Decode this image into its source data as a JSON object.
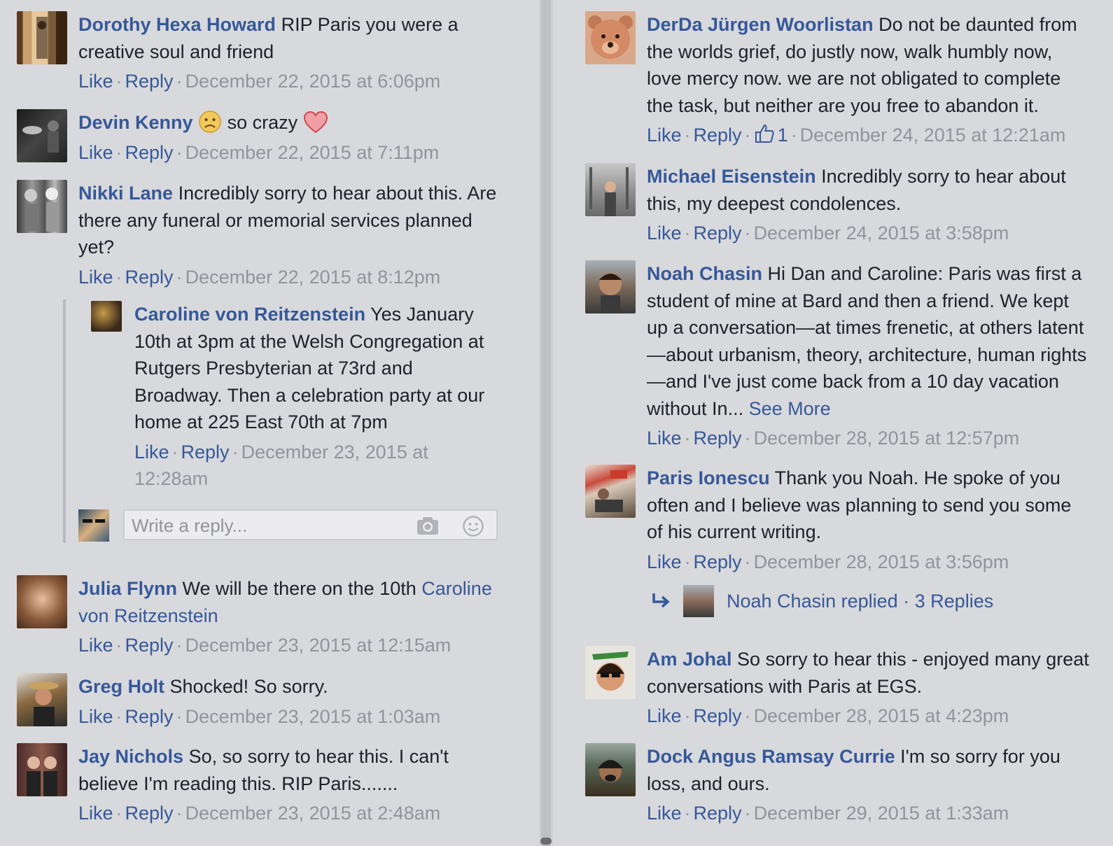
{
  "left": {
    "comments": [
      {
        "name": "Dorothy Hexa Howard",
        "text": "RIP Paris you were a creative soul and friend",
        "like": "Like",
        "reply": "Reply",
        "timestamp": "December 22, 2015 at 6:06pm"
      },
      {
        "name": "Devin Kenny",
        "text_before": "so crazy",
        "like": "Like",
        "reply": "Reply",
        "timestamp": "December 22, 2015 at 7:11pm"
      },
      {
        "name": "Nikki Lane",
        "text": "Incredibly sorry to hear about this. Are there any funeral or memorial services planned yet?",
        "like": "Like",
        "reply": "Reply",
        "timestamp": "December 22, 2015 at 8:12pm"
      },
      {
        "name": "Julia Flynn",
        "text": "We will be there on the 10th",
        "mention": "Caroline von Reitzenstein",
        "like": "Like",
        "reply": "Reply",
        "timestamp": "December 23, 2015 at 12:15am"
      },
      {
        "name": "Greg Holt",
        "text": "Shocked! So sorry.",
        "like": "Like",
        "reply": "Reply",
        "timestamp": "December 23, 2015 at 1:03am"
      },
      {
        "name": "Jay Nichols",
        "text": "So, so sorry to hear this. I can't believe I'm reading this. RIP Paris.......",
        "like": "Like",
        "reply": "Reply",
        "timestamp": "December 23, 2015 at 2:48am"
      }
    ],
    "nested_reply": {
      "name": "Caroline von Reitzenstein",
      "text": "Yes January 10th at 3pm at the Welsh Congregation at Rutgers Presbyterian at 73rd and Broadway. Then a celebration party at our home at 225 East 70th at 7pm",
      "like": "Like",
      "reply": "Reply",
      "timestamp": "December 23, 2015 at 12:28am"
    },
    "reply_box": {
      "placeholder": "Write a reply..."
    }
  },
  "right": {
    "comments": [
      {
        "name": "DerDa Jürgen Woorlistan",
        "text": "Do not be daunted from the worlds grief, do justly now, walk humbly now, love mercy now. we are not obligated to complete the task, but neither are you free to abandon it.",
        "like": "Like",
        "reply": "Reply",
        "like_count": "1",
        "timestamp": "December 24, 2015 at 12:21am"
      },
      {
        "name": "Michael Eisenstein",
        "text": "Incredibly sorry to hear about this, my deepest condolences.",
        "like": "Like",
        "reply": "Reply",
        "timestamp": "December 24, 2015 at 3:58pm"
      },
      {
        "name": "Noah Chasin",
        "text": "Hi Dan and Caroline: Paris was first a student of mine at Bard and then a friend. We kept up a conversation—at times frenetic, at others latent—about urbanism, theory, architecture, human rights—and I've just come back from a 10 day vacation without In...",
        "see_more": "See More",
        "like": "Like",
        "reply": "Reply",
        "timestamp": "December 28, 2015 at 12:57pm"
      },
      {
        "name": "Paris Ionescu",
        "text": "Thank you Noah. He spoke of you often and I believe was planning to send you some of his current writing.",
        "like": "Like",
        "reply": "Reply",
        "timestamp": "December 28, 2015 at 3:56pm"
      },
      {
        "name": "Am Johal",
        "text": "So sorry to hear this - enjoyed many great conversations with Paris at EGS.",
        "like": "Like",
        "reply": "Reply",
        "timestamp": "December 28, 2015 at 4:23pm"
      },
      {
        "name": "Dock Angus Ramsay Currie",
        "text": "I'm so sorry for you loss, and ours.",
        "like": "Like",
        "reply": "Reply",
        "timestamp": "December 29, 2015 at 1:33am"
      }
    ],
    "replied_summary": {
      "text": "Noah Chasin replied · 3 Replies"
    }
  },
  "colors": {
    "link": "#365899",
    "meta": "#90949c",
    "text": "#1d2129",
    "background": "#d8d9dc"
  }
}
